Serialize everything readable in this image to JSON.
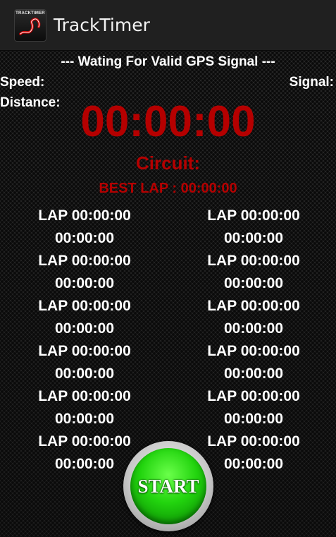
{
  "app": {
    "title": "TrackTimer",
    "icon_text": "TRACKTIMER"
  },
  "status": {
    "gps_message": "--- Wating For Valid GPS Signal ---",
    "speed_label": "Speed:",
    "signal_label": "Signal:",
    "distance_label": "Distance:"
  },
  "timer": {
    "main": "00:00:00",
    "circuit_label": "Circuit:",
    "best_lap": "BEST LAP : 00:00:00"
  },
  "laps": {
    "left": [
      {
        "label": "LAP 00:00:00",
        "time": "00:00:00"
      },
      {
        "label": "LAP 00:00:00",
        "time": "00:00:00"
      },
      {
        "label": "LAP 00:00:00",
        "time": "00:00:00"
      },
      {
        "label": "LAP 00:00:00",
        "time": "00:00:00"
      },
      {
        "label": "LAP 00:00:00",
        "time": "00:00:00"
      },
      {
        "label": "LAP 00:00:00",
        "time": "00:00:00"
      }
    ],
    "right": [
      {
        "label": "LAP 00:00:00",
        "time": "00:00:00"
      },
      {
        "label": "LAP 00:00:00",
        "time": "00:00:00"
      },
      {
        "label": "LAP 00:00:00",
        "time": "00:00:00"
      },
      {
        "label": "LAP 00:00:00",
        "time": "00:00:00"
      },
      {
        "label": "LAP 00:00:00",
        "time": "00:00:00"
      },
      {
        "label": "LAP 00:00:00",
        "time": "00:00:00"
      }
    ]
  },
  "controls": {
    "start_label": "START"
  },
  "colors": {
    "timer_red": "#b50000",
    "start_green": "#22d40e",
    "text_white": "#ffffff"
  }
}
